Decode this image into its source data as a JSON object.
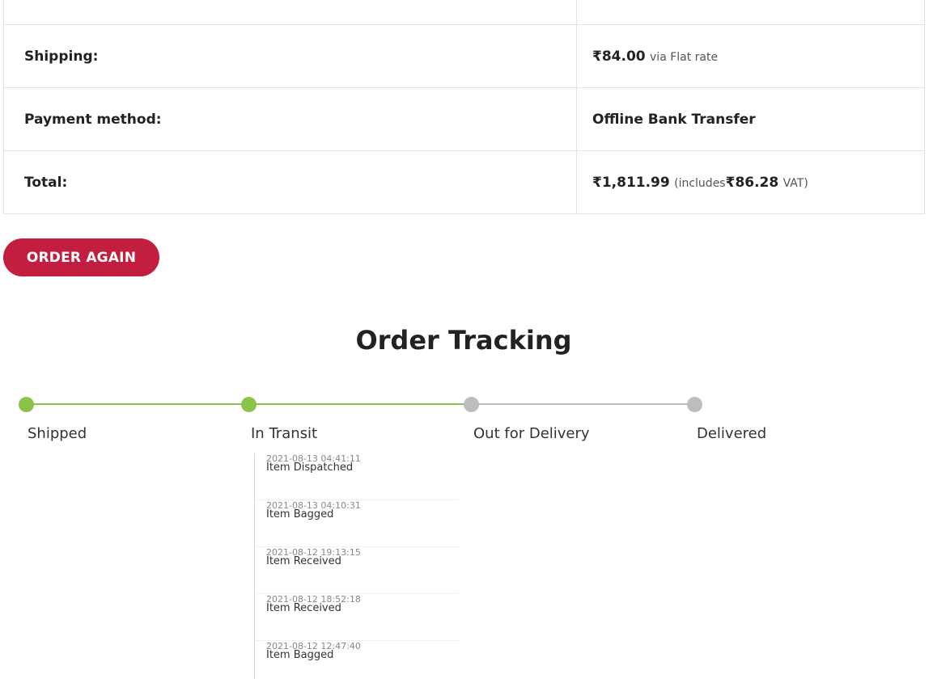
{
  "totals": {
    "shipping_label": "Shipping:",
    "shipping_amount": "₹84.00",
    "shipping_note": "via Flat rate",
    "payment_label": "Payment method:",
    "payment_value": "Offline Bank Transfer",
    "total_label": "Total:",
    "total_amount": "₹1,811.99",
    "total_note_open": "(includes",
    "total_vat_amount": "₹86.28",
    "total_note_close": "VAT)"
  },
  "order_again_label": "ORDER AGAIN",
  "tracking": {
    "title": "Order Tracking",
    "completed_color": "#8bc34a",
    "pending_color": "#bdbdbd",
    "steps": [
      {
        "label": "Shipped",
        "status": "complete"
      },
      {
        "label": "In Transit",
        "status": "complete"
      },
      {
        "label": "Out for Delivery",
        "status": "pending"
      },
      {
        "label": "Delivered",
        "status": "pending"
      }
    ],
    "events": [
      {
        "timestamp": "2021-08-13 04:41:11",
        "message": "Item Dispatched"
      },
      {
        "timestamp": "2021-08-13 04:10:31",
        "message": "Item Bagged"
      },
      {
        "timestamp": "2021-08-12 19:13:15",
        "message": "Item Received"
      },
      {
        "timestamp": "2021-08-12 18:52:18",
        "message": "Item Received"
      },
      {
        "timestamp": "2021-08-12 12:47:40",
        "message": "Item Bagged"
      }
    ]
  },
  "colors": {
    "accent": "#c21e3f"
  }
}
